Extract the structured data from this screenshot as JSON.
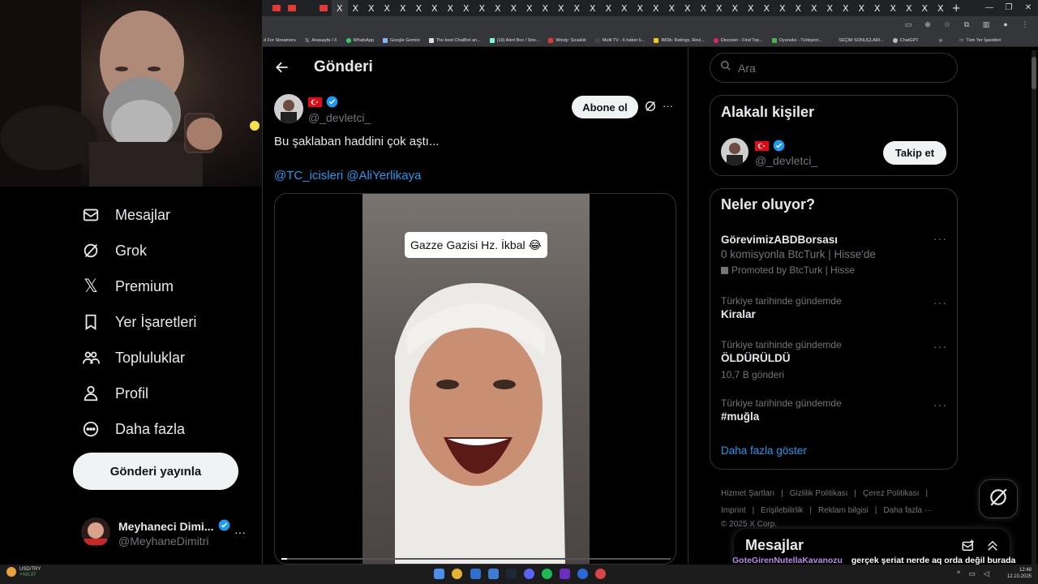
{
  "browser": {
    "tabs": [
      "",
      "",
      "",
      "X",
      "X",
      "X",
      "X",
      "X",
      "X",
      "X",
      "X",
      "X",
      "X",
      "X",
      "X",
      "X",
      "X",
      "X",
      "X",
      "X",
      "X",
      "X",
      "X",
      "X",
      "X",
      "X",
      "X",
      "X",
      "X",
      "X",
      "X",
      "X",
      "X",
      "X",
      "X",
      "X",
      "X",
      "X",
      "X",
      "X",
      "X",
      "X",
      "X"
    ],
    "new_tab": "+",
    "bookmarks": [
      "d For Streamers",
      "Anasayfa / X",
      "WhatsApp",
      "Google Gemini",
      "The best ChatBot an...",
      "(19) Alert Box / Stre...",
      "Windy: Sıcaklık",
      "Multi TV - 6 haber k...",
      "IMDb: Ratings, Revi...",
      "Discover - Find Top...",
      "Oyuneks - Türkiyeni...",
      "SEÇİM SONUÇLARI...",
      "ChatGPT"
    ],
    "bookmarks_overflow": "»",
    "all_bookmarks": "Tüm Yer İşaretleri"
  },
  "nav": {
    "items": [
      {
        "label": "Mesajlar",
        "icon": "mail-icon"
      },
      {
        "label": "Grok",
        "icon": "grok-icon"
      },
      {
        "label": "Premium",
        "icon": "x-logo-icon"
      },
      {
        "label": "Yer İşaretleri",
        "icon": "bookmark-icon"
      },
      {
        "label": "Topluluklar",
        "icon": "communities-icon"
      },
      {
        "label": "Profil",
        "icon": "profile-icon"
      },
      {
        "label": "Daha fazla",
        "icon": "more-circle-icon"
      }
    ],
    "post_button": "Gönderi yayınla",
    "account": {
      "name": "Meyhaneci Dimi...",
      "handle": "@MeyhaneDimitri",
      "more": "···"
    }
  },
  "post": {
    "header_title": "Gönderi",
    "author_handle": "@_devletci_",
    "subscribe_label": "Abone ol",
    "more": "···",
    "text": "Bu şaklaban haddini çok aştı...",
    "mention_1": "@TC_icisleri",
    "mention_2": "@AliYerlikaya",
    "video_caption": "Gazze Gazisi Hz. İkbal 😂"
  },
  "search": {
    "placeholder": "Ara"
  },
  "related": {
    "title": "Alakalı kişiler",
    "handle": "@_devletci_",
    "follow_label": "Takip et"
  },
  "trends": {
    "title": "Neler oluyor?",
    "items": [
      {
        "title": "GörevimizABDBorsası",
        "desc": "0 komisyonla BtcTurk | Hisse'de",
        "promo": "Promoted by BtcTurk | Hisse"
      },
      {
        "label": "Türkiye tarihinde gündemde",
        "title": "Kiralar"
      },
      {
        "label": "Türkiye tarihinde gündemde",
        "title": "ÖLDÜRÜLDÜ",
        "count": "10,7 B gönderi"
      },
      {
        "label": "Türkiye tarihinde gündemde",
        "title": "#muğla"
      }
    ],
    "more": "···",
    "show_more": "Daha fazla göster"
  },
  "footer": {
    "links": [
      "Hizmet Şartları",
      "Gizlilik Politikası",
      "Çerez Politikası",
      "Imprint",
      "Erişilebilirlik",
      "Reklam bilgisi",
      "Daha fazla ···"
    ],
    "sep": "|",
    "copyright": "© 2025 X Corp."
  },
  "messages_drawer": {
    "title": "Mesajlar"
  },
  "chat_overlay": {
    "user": "GoteGirenNutellaKavanozu",
    "message": "gerçek şeriat nerde aq orda değil burada değil nerde bu"
  },
  "taskbar": {
    "ticker_symbol": "USD/TRY",
    "ticker_change": "+%0,87",
    "time": "12:48",
    "date": "12.10.2025"
  },
  "colors": {
    "accent": "#1d9bf0",
    "bg": "#000000",
    "border": "#2f3336"
  }
}
